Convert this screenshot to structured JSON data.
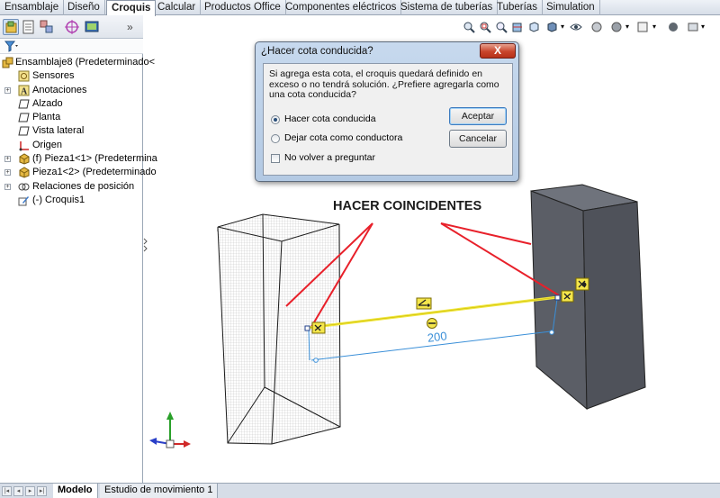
{
  "tabs": [
    "Ensamblaje",
    "Diseño",
    "Croquis",
    "Calcular",
    "Productos Office",
    "Componentes eléctricos",
    "Sistema de tuberías",
    "Tuberías",
    "Simulation"
  ],
  "active_tab": "Croquis",
  "feature_tree": {
    "items": [
      {
        "label": "Ensamblaje8  (Predeterminado<",
        "icon": "assembly-icon"
      },
      {
        "label": "Sensores",
        "icon": "sensor-icon"
      },
      {
        "label": "Anotaciones",
        "icon": "annotation-icon"
      },
      {
        "label": "Alzado",
        "icon": "plane-icon"
      },
      {
        "label": "Planta",
        "icon": "plane-icon"
      },
      {
        "label": "Vista lateral",
        "icon": "plane-icon"
      },
      {
        "label": "Origen",
        "icon": "origin-icon"
      },
      {
        "label": "(f) Pieza1<1> (Predetermina",
        "icon": "part-icon"
      },
      {
        "label": "Pieza1<2> (Predeterminado",
        "icon": "part-icon"
      },
      {
        "label": "Relaciones de posición",
        "icon": "mates-icon"
      },
      {
        "label": "(-) Croquis1",
        "icon": "sketch-icon"
      }
    ]
  },
  "dialog": {
    "title": "¿Hacer cota conducida?",
    "close": "X",
    "message": "Si agrega esta cota, el croquis quedará definido en exceso o no tendrá solución. ¿Prefiere agregarla como una cota conducida?",
    "option_driven": "Hacer cota conducida",
    "option_driving": "Dejar cota como conductora",
    "dont_ask": "No volver a preguntar",
    "accept": "Aceptar",
    "cancel": "Cancelar"
  },
  "annotation": {
    "label": "HACER COINCIDENTES",
    "dimension_value": "200"
  },
  "bottom_tabs": [
    "Modelo",
    "Estudio de movimiento 1"
  ],
  "active_bottom_tab": "Modelo",
  "colors": {
    "annotation_lines": "#e8202a",
    "sketch_line": "#f0e63c",
    "dimension": "#3a8fd8",
    "block_right": "#5b5e66"
  }
}
